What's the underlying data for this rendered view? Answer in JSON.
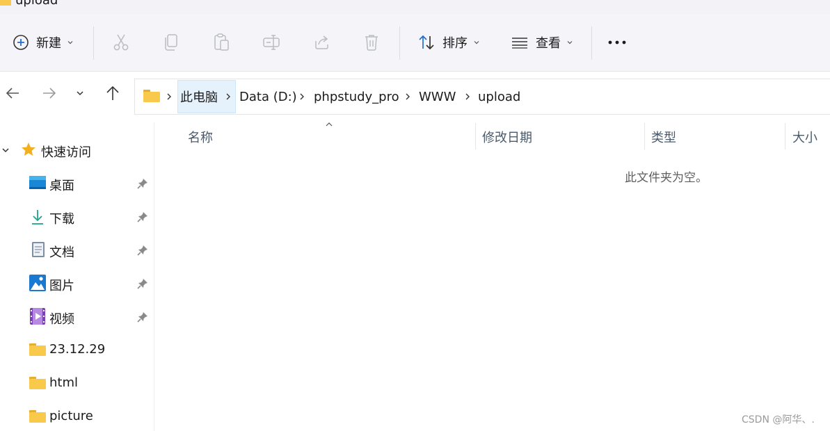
{
  "window": {
    "title": "upload"
  },
  "toolbar": {
    "new_label": "新建",
    "cut_icon": "cut-icon",
    "copy_icon": "copy-icon",
    "paste_icon": "paste-icon",
    "rename_icon": "rename-icon",
    "share_icon": "share-icon",
    "delete_icon": "delete-icon",
    "sort_label": "排序",
    "view_label": "查看",
    "more_icon": "more-icon"
  },
  "nav": {
    "back_icon": "back-arrow-icon",
    "forward_icon": "forward-arrow-icon",
    "recent_icon": "chevron-down-icon",
    "up_icon": "up-arrow-icon"
  },
  "breadcrumb": [
    "此电脑",
    "Data (D:)",
    "phpstudy_pro",
    "WWW",
    "upload"
  ],
  "sidebar": {
    "quick_access_label": "快速访问",
    "items": [
      {
        "label": "桌面",
        "icon": "desktop-icon",
        "pinned": true
      },
      {
        "label": "下载",
        "icon": "download-icon",
        "pinned": true
      },
      {
        "label": "文档",
        "icon": "documents-icon",
        "pinned": true
      },
      {
        "label": "图片",
        "icon": "pictures-icon",
        "pinned": true
      },
      {
        "label": "视频",
        "icon": "videos-icon",
        "pinned": true
      },
      {
        "label": "23.12.29",
        "icon": "folder-icon",
        "pinned": false
      },
      {
        "label": "html",
        "icon": "folder-icon",
        "pinned": false
      },
      {
        "label": "picture",
        "icon": "folder-icon",
        "pinned": false
      }
    ]
  },
  "content": {
    "columns": [
      "名称",
      "修改日期",
      "类型",
      "大小"
    ],
    "sorted_column": "名称",
    "empty_message": "此文件夹为空。"
  },
  "watermark": "CSDN @阿华、.",
  "colors": {
    "toolbar_bg": "#f4f4f9",
    "accent_blue": "#1f6fd0",
    "folder_yellow": "#f8c94a",
    "star_yellow": "#f2b01e",
    "crumb_highlight": "#e6f2fb"
  }
}
